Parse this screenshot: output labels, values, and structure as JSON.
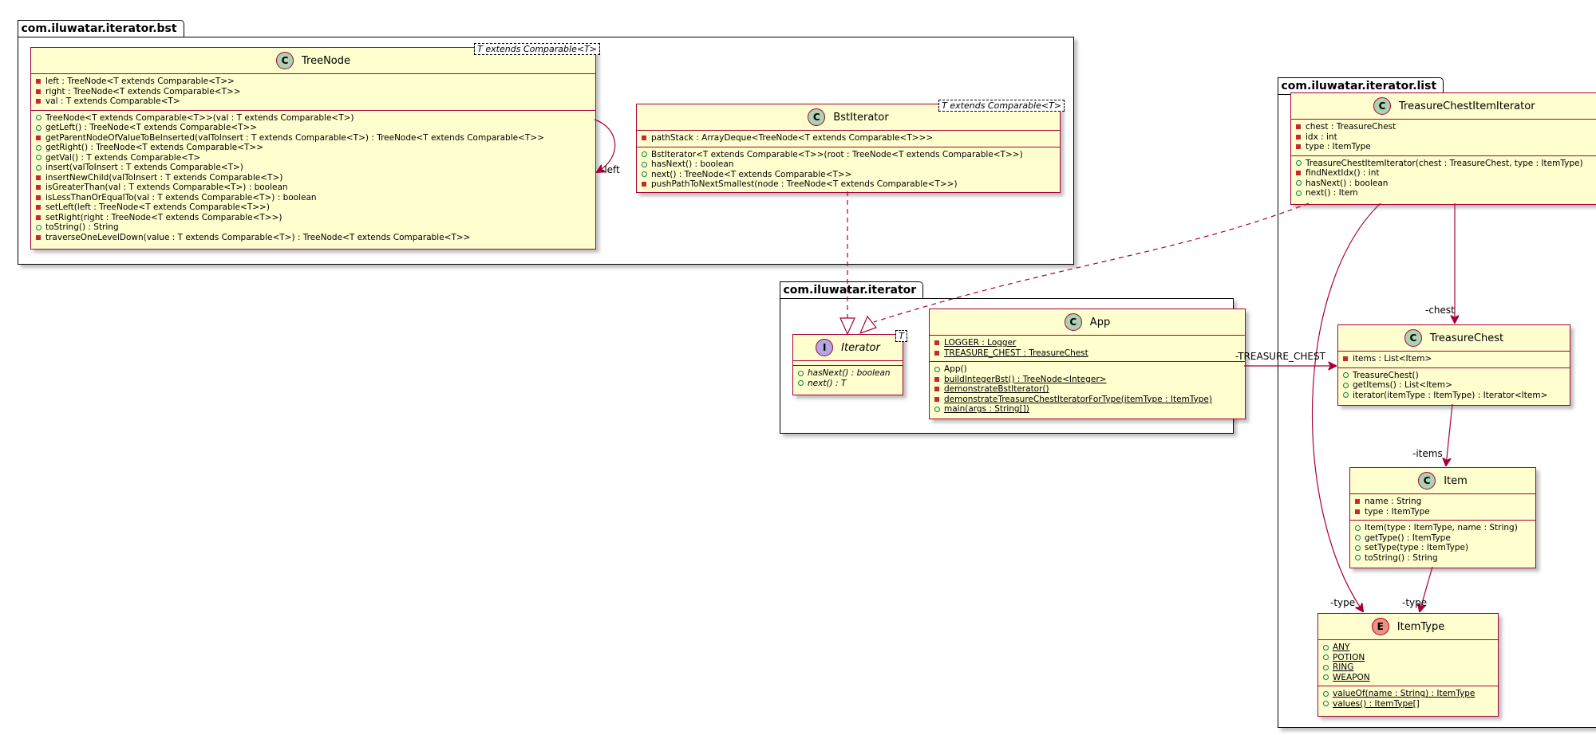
{
  "packages": {
    "bst": "com.iluwatar.iterator.bst",
    "list": "com.iluwatar.iterator.list",
    "iterator": "com.iluwatar.iterator"
  },
  "classes": {
    "treenode": {
      "name": "TreeNode",
      "generic": "T extends Comparable<T>",
      "fields": [
        "left : TreeNode<T extends Comparable<T>>",
        "right : TreeNode<T extends Comparable<T>>",
        "val : T extends Comparable<T>"
      ],
      "methods": [
        "TreeNode<T extends Comparable<T>>(val : T extends Comparable<T>)",
        "getLeft() : TreeNode<T extends Comparable<T>>",
        "getParentNodeOfValueToBeInserted(valToInsert : T extends Comparable<T>) : TreeNode<T extends Comparable<T>>",
        "getRight() : TreeNode<T extends Comparable<T>>",
        "getVal() : T extends Comparable<T>",
        "insert(valToInsert : T extends Comparable<T>)",
        "insertNewChild(valToInsert : T extends Comparable<T>)",
        "isGreaterThan(val : T extends Comparable<T>) : boolean",
        "isLessThanOrEqualTo(val : T extends Comparable<T>) : boolean",
        "setLeft(left : TreeNode<T extends Comparable<T>>)",
        "setRight(right : TreeNode<T extends Comparable<T>>)",
        "toString() : String",
        "traverseOneLevelDown(value : T extends Comparable<T>) : TreeNode<T extends Comparable<T>>"
      ]
    },
    "bstiterator": {
      "name": "BstIterator",
      "generic": "T extends Comparable<T>",
      "fields": [
        "pathStack : ArrayDeque<TreeNode<T extends Comparable<T>>>"
      ],
      "methods": [
        "BstIterator<T extends Comparable<T>>(root : TreeNode<T extends Comparable<T>>)",
        "hasNext() : boolean",
        "next() : TreeNode<T extends Comparable<T>>",
        "pushPathToNextSmallest(node : TreeNode<T extends Comparable<T>>)"
      ]
    },
    "iterator": {
      "name": "Iterator",
      "generic": "T",
      "methods": [
        "hasNext() : boolean",
        "next() : T"
      ]
    },
    "app": {
      "name": "App",
      "fields": [
        "LOGGER : Logger",
        "TREASURE_CHEST : TreasureChest"
      ],
      "methods": [
        "App()",
        "buildIntegerBst() : TreeNode<Integer>",
        "demonstrateBstIterator()",
        "demonstrateTreasureChestIteratorForType(itemType : ItemType)",
        "main(args : String[])"
      ]
    },
    "tcii": {
      "name": "TreasureChestItemIterator",
      "fields": [
        "chest : TreasureChest",
        "idx : int",
        "type : ItemType"
      ],
      "methods": [
        "TreasureChestItemIterator(chest : TreasureChest, type : ItemType)",
        "findNextIdx() : int",
        "hasNext() : boolean",
        "next() : Item"
      ]
    },
    "treasurechest": {
      "name": "TreasureChest",
      "fields": [
        "items : List<Item>"
      ],
      "methods": [
        "TreasureChest()",
        "getItems() : List<Item>",
        "iterator(itemType : ItemType) : Iterator<Item>"
      ]
    },
    "item": {
      "name": "Item",
      "fields": [
        "name : String",
        "type : ItemType"
      ],
      "methods": [
        "Item(type : ItemType, name : String)",
        "getType() : ItemType",
        "setType(type : ItemType)",
        "toString() : String"
      ]
    },
    "itemtype": {
      "name": "ItemType",
      "fields": [
        "ANY",
        "POTION",
        "RING",
        "WEAPON"
      ],
      "methods": [
        "valueOf(name : String) : ItemType",
        "values() : ItemType[]"
      ]
    }
  },
  "relations": {
    "left": "-left",
    "treasure_chest": "-TREASURE_CHEST",
    "chest": "-chest",
    "items": "-items",
    "type_a": "-type",
    "type_b": "-type"
  }
}
